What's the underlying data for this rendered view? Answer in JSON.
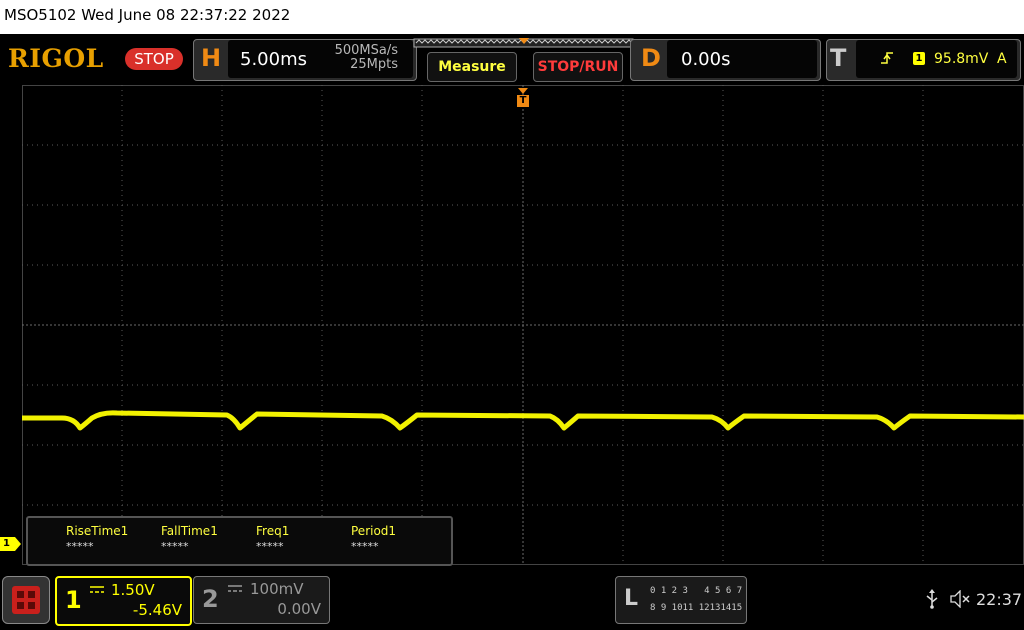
{
  "status_bar": {
    "text": "MSO5102  Wed June 08 22:37:22 2022"
  },
  "brand": {
    "logo": "RIGOL",
    "run_state": "STOP"
  },
  "horizontal": {
    "letter": "H",
    "timebase": "5.00ms",
    "sample_rate": "500MSa/s",
    "memory_depth": "25Mpts"
  },
  "buttons": {
    "measure": "Measure",
    "stop_run": "STOP/RUN"
  },
  "delay": {
    "letter": "D",
    "value": "0.00s"
  },
  "trigger": {
    "letter": "T",
    "source": "1",
    "level": "95.8mV",
    "mode": "A"
  },
  "trigger_marker": {
    "label": "T"
  },
  "ch1_ground_marker": {
    "label": "1"
  },
  "measurements": [
    {
      "label": "RiseTime1",
      "value": "*****"
    },
    {
      "label": "FallTime1",
      "value": "*****"
    },
    {
      "label": "Freq1",
      "value": "*****"
    },
    {
      "label": "Period1",
      "value": "*****"
    }
  ],
  "channel1": {
    "number": "1",
    "scale": "1.50V",
    "offset": "-5.46V",
    "color": "#ffff00"
  },
  "channel2": {
    "number": "2",
    "scale": "100mV",
    "offset": "0.00V"
  },
  "logic": {
    "letter": "L",
    "row1": "0 1 2 3   4 5 6 7",
    "row2": "8 9 1011 12131415"
  },
  "clock": {
    "time": "22:37"
  },
  "icons": {
    "menu": "grid-menu-icon",
    "usb": "usb-icon",
    "mute": "mute-icon"
  },
  "colors": {
    "accent": "#f08a14",
    "stop": "#d9302a",
    "trace": "#ffff00",
    "grid": "#5a5a5a"
  }
}
